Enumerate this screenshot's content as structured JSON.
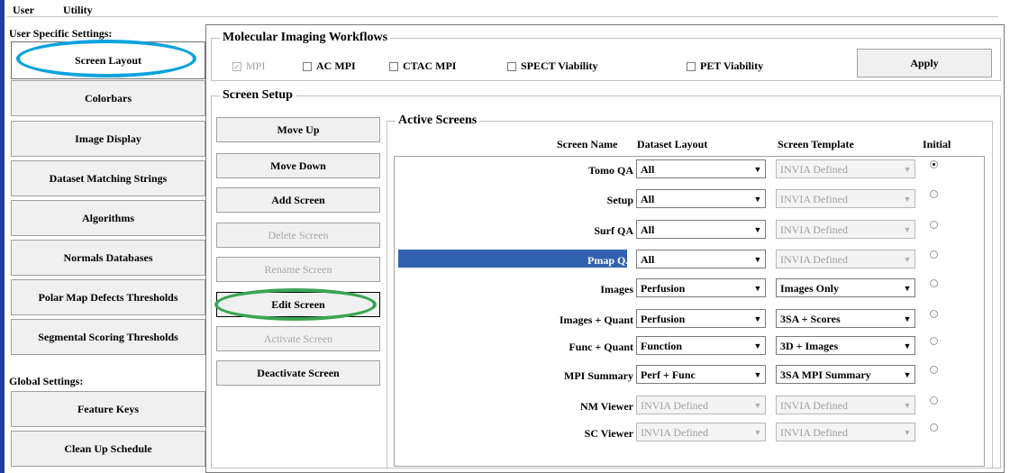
{
  "menu": {
    "items": [
      "User",
      "Utility"
    ]
  },
  "sidebar": {
    "user_section_label": "User Specific Settings:",
    "user_items": [
      {
        "label": "Screen Layout"
      },
      {
        "label": "Colorbars"
      },
      {
        "label": "Image Display"
      },
      {
        "label": "Dataset Matching Strings"
      },
      {
        "label": "Algorithms"
      },
      {
        "label": "Normals Databases"
      },
      {
        "label": "Polar Map Defects Thresholds"
      },
      {
        "label": "Segmental Scoring Thresholds"
      }
    ],
    "global_section_label": "Global Settings:",
    "global_items": [
      {
        "label": "Feature Keys"
      },
      {
        "label": "Clean Up Schedule"
      }
    ]
  },
  "workflows": {
    "title": "Molecular Imaging Workflows",
    "options": [
      {
        "label": "MPI",
        "checked": true,
        "enabled": false
      },
      {
        "label": "AC MPI",
        "checked": false,
        "enabled": true
      },
      {
        "label": "CTAC MPI",
        "checked": false,
        "enabled": true
      },
      {
        "label": "SPECT Viability",
        "checked": false,
        "enabled": true
      },
      {
        "label": "PET Viability",
        "checked": false,
        "enabled": true
      }
    ],
    "apply_label": "Apply"
  },
  "screen_setup": {
    "title": "Screen Setup",
    "buttons": [
      {
        "label": "Move Up",
        "enabled": true
      },
      {
        "label": "Move Down",
        "enabled": true
      },
      {
        "label": "Add Screen",
        "enabled": true
      },
      {
        "label": "Delete Screen",
        "enabled": false
      },
      {
        "label": "Rename Screen",
        "enabled": false
      },
      {
        "label": "Edit Screen",
        "enabled": true
      },
      {
        "label": "Activate Screen",
        "enabled": false
      },
      {
        "label": "Deactivate Screen",
        "enabled": true
      }
    ]
  },
  "active_screens": {
    "title": "Active Screens",
    "headers": {
      "name": "Screen Name",
      "dataset": "Dataset Layout",
      "template": "Screen Template",
      "initial": "Initial"
    },
    "rows": [
      {
        "name": "Tomo QA",
        "dataset": "All",
        "dataset_enabled": true,
        "template": "INVIA Defined",
        "template_enabled": false,
        "initial": true,
        "selected": false
      },
      {
        "name": "Setup",
        "dataset": "All",
        "dataset_enabled": true,
        "template": "INVIA Defined",
        "template_enabled": false,
        "initial": false,
        "selected": false
      },
      {
        "name": "Surf QA",
        "dataset": "All",
        "dataset_enabled": true,
        "template": "INVIA Defined",
        "template_enabled": false,
        "initial": false,
        "selected": false
      },
      {
        "name": "Pmap QA",
        "dataset": "All",
        "dataset_enabled": true,
        "template": "INVIA Defined",
        "template_enabled": false,
        "initial": false,
        "selected": true
      },
      {
        "name": "Images",
        "dataset": "Perfusion",
        "dataset_enabled": true,
        "template": "Images Only",
        "template_enabled": true,
        "initial": false,
        "selected": false
      },
      {
        "name": "Images + Quant",
        "dataset": "Perfusion",
        "dataset_enabled": true,
        "template": "3SA + Scores",
        "template_enabled": true,
        "initial": false,
        "selected": false
      },
      {
        "name": "Func + Quant",
        "dataset": "Function",
        "dataset_enabled": true,
        "template": "3D + Images",
        "template_enabled": true,
        "initial": false,
        "selected": false
      },
      {
        "name": "MPI Summary",
        "dataset": "Perf + Func",
        "dataset_enabled": true,
        "template": "3SA MPI Summary",
        "template_enabled": true,
        "initial": false,
        "selected": false
      },
      {
        "name": "NM Viewer",
        "dataset": "INVIA Defined",
        "dataset_enabled": false,
        "template": "INVIA Defined",
        "template_enabled": false,
        "initial": false,
        "selected": false
      },
      {
        "name": "SC Viewer",
        "dataset": "INVIA Defined",
        "dataset_enabled": false,
        "template": "INVIA Defined",
        "template_enabled": false,
        "initial": false,
        "selected": false
      }
    ]
  },
  "annotation_colors": {
    "blue": "#0aa2dd",
    "green": "#3aa552"
  }
}
